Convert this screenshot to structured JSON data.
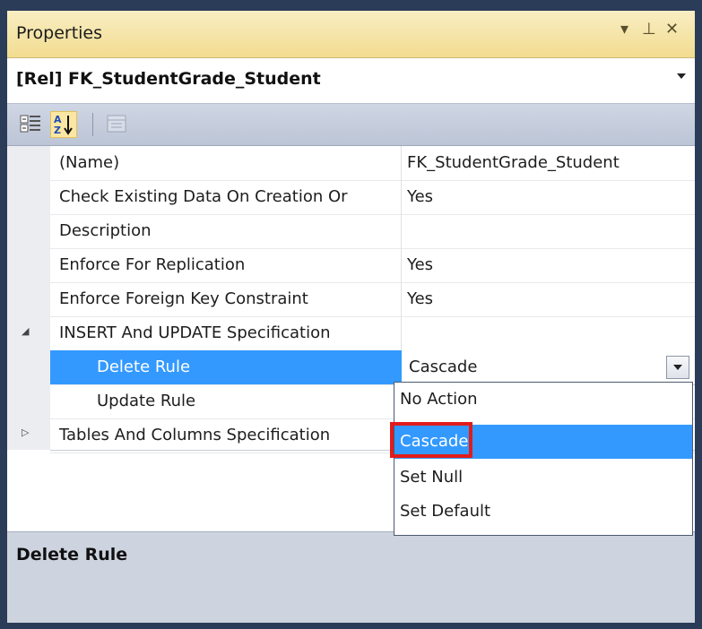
{
  "window": {
    "title": "Properties",
    "pin_icon": "pin-icon",
    "close_icon": "close-icon",
    "dropdown_icon": "chevron-down-icon"
  },
  "object_selector": {
    "value": "[Rel] FK_StudentGrade_Student"
  },
  "toolbar": {
    "categorized_icon": "categorized-icon",
    "alphabetical_icon": "sort-az-icon",
    "property_pages_icon": "property-pages-icon"
  },
  "properties": [
    {
      "name": "(Name)",
      "value": "FK_StudentGrade_Student"
    },
    {
      "name": "Check Existing Data On Creation Or",
      "value": "Yes"
    },
    {
      "name": "Description",
      "value": ""
    },
    {
      "name": "Enforce For Replication",
      "value": "Yes"
    },
    {
      "name": "Enforce Foreign Key Constraint",
      "value": "Yes"
    },
    {
      "name": "INSERT And UPDATE Specification",
      "value": ""
    },
    {
      "name": "Delete Rule",
      "value": "Cascade"
    },
    {
      "name": "Update Rule",
      "value": "No Action"
    },
    {
      "name": "Tables And Columns Specification",
      "value": ""
    }
  ],
  "dropdown": {
    "options": [
      "No Action",
      "Cascade",
      "Set Null",
      "Set Default"
    ],
    "selected": "Cascade"
  },
  "description": {
    "title": "Delete Rule"
  }
}
